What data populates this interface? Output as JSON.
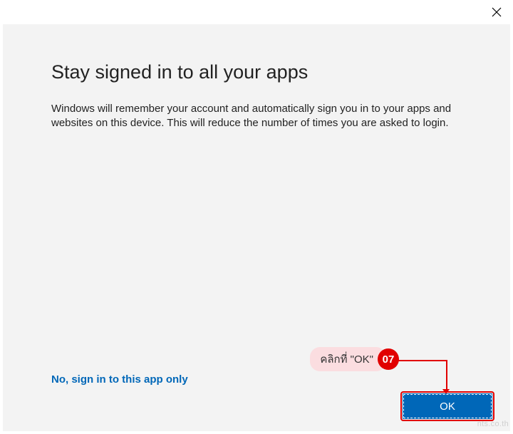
{
  "dialog": {
    "title": "Stay signed in to all your apps",
    "body": "Windows will remember your account and automatically sign you in to your apps and websites on this device. This will reduce the number of times you are asked to login.",
    "link_only": "No, sign in to this app only",
    "ok_label": "OK"
  },
  "annotation": {
    "callout_text": "คลิกที่ \"OK\"",
    "step_number": "07"
  },
  "watermark": "nts.co.th"
}
